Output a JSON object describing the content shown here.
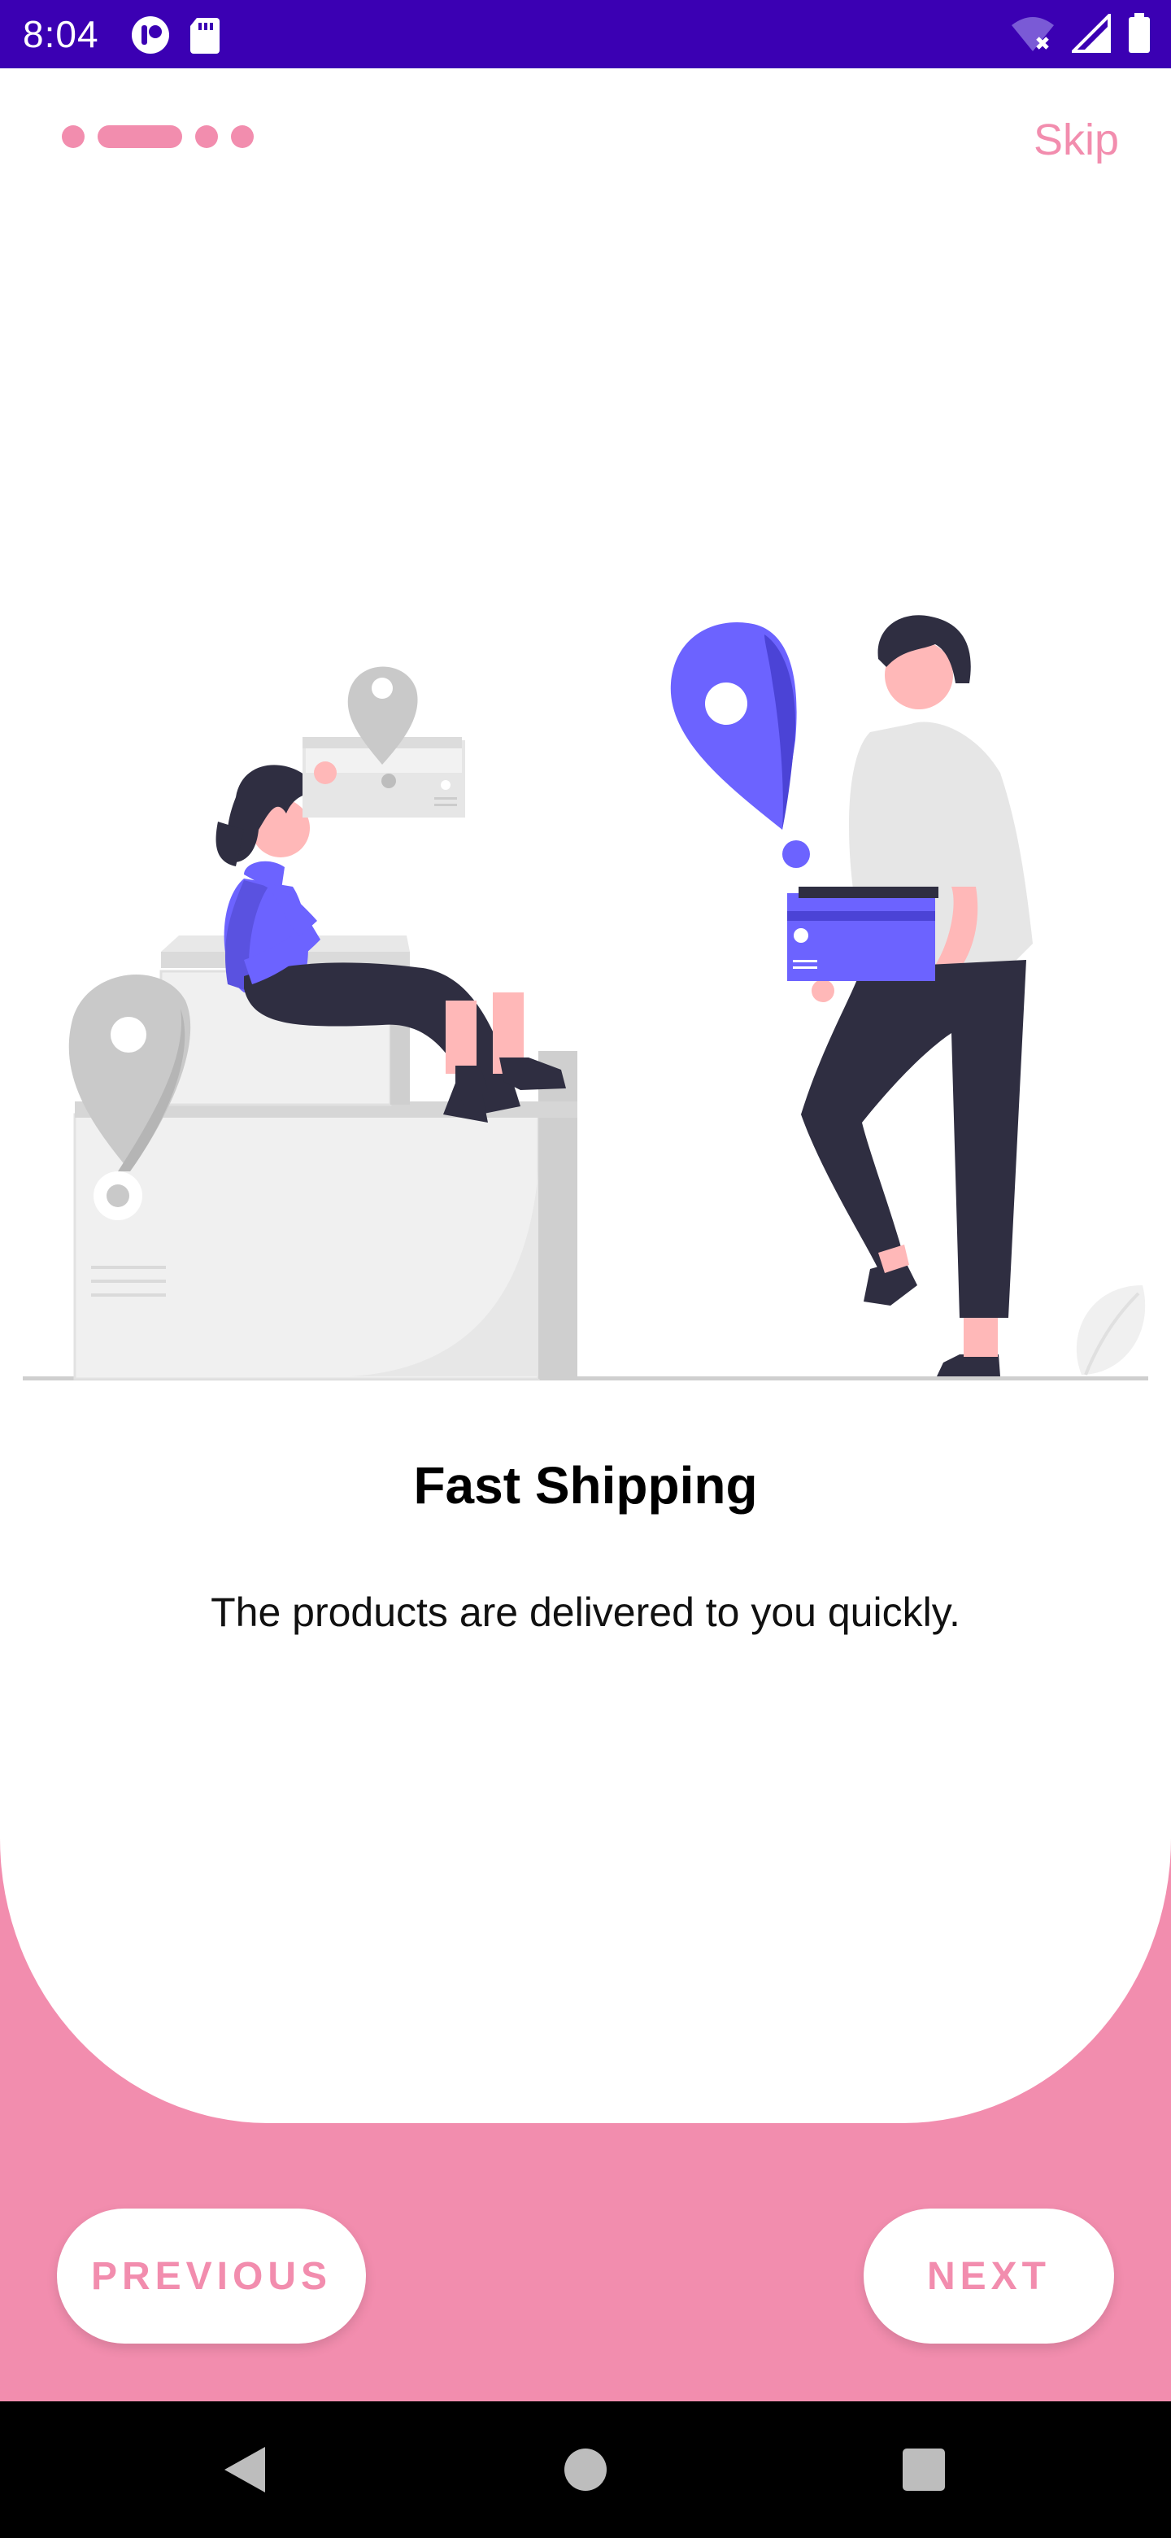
{
  "status_bar": {
    "time": "8:04",
    "icons": [
      "app-icon",
      "sd-card-icon",
      "wifi-off-icon",
      "cell-signal-icon",
      "battery-icon"
    ],
    "background": "#3B00B3"
  },
  "onboarding": {
    "page_count": 4,
    "current_page": 2,
    "skip_label": "Skip",
    "title": "Fast Shipping",
    "description": "The products are delivered to you quickly.",
    "previous_label": "PREVIOUS",
    "next_label": "NEXT",
    "accent_color": "#F28DAE",
    "illustration_primary": "#6C63FF"
  },
  "navigation_bar": {
    "icons": [
      "back-icon",
      "home-icon",
      "recents-icon"
    ]
  }
}
